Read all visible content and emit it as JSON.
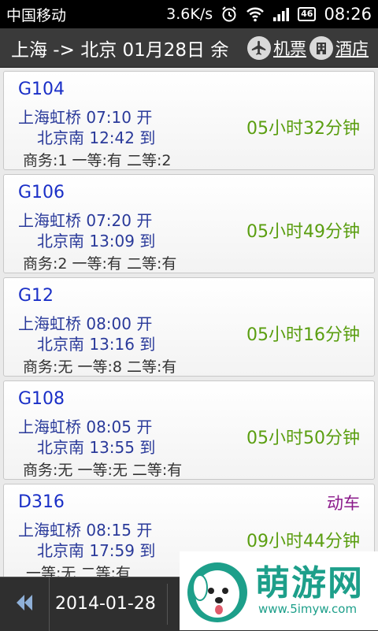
{
  "status_bar": {
    "carrier": "中国移动",
    "net_speed": "3.6K/s",
    "network_badge": "46",
    "time": "08:26",
    "icons": [
      "alarm-icon",
      "wifi-icon",
      "signal-icon"
    ]
  },
  "title_bar": {
    "route": "上海 -> 北京 01月28日 余",
    "flight_label": "机票",
    "hotel_label": "酒店"
  },
  "trains": [
    {
      "number": "G104",
      "depart": "上海虹桥 07:10 开",
      "arrive": "北京南 12:42 到",
      "seats": "商务:1 一等:有 二等:2",
      "duration": "05小时32分钟",
      "type": ""
    },
    {
      "number": "G106",
      "depart": "上海虹桥 07:20 开",
      "arrive": "北京南 13:09 到",
      "seats": "商务:2 一等:有 二等:有",
      "duration": "05小时49分钟",
      "type": ""
    },
    {
      "number": "G12",
      "depart": "上海虹桥 08:00 开",
      "arrive": "北京南 13:16 到",
      "seats": "商务:无 一等:8 二等:有",
      "duration": "05小时16分钟",
      "type": ""
    },
    {
      "number": "G108",
      "depart": "上海虹桥 08:05 开",
      "arrive": "北京南 13:55 到",
      "seats": "商务:无 一等:无 二等:有",
      "duration": "05小时50分钟",
      "type": ""
    },
    {
      "number": "D316",
      "depart": "上海虹桥 08:15 开",
      "arrive": "北京南 17:59 到",
      "seats": "一等:无 二等:有",
      "duration": "09小时44分钟",
      "type": "动车"
    }
  ],
  "bottom_bar": {
    "date": "2014-01-28"
  },
  "watermark": {
    "brand": "萌游网",
    "url": "www.5imyw.com"
  },
  "colors": {
    "train_number": "#1a2fc7",
    "duration": "#5a9e10",
    "train_type": "#8b1a8b",
    "title_bg": "#3a3a3a",
    "watermark": "#1d9f8a"
  }
}
